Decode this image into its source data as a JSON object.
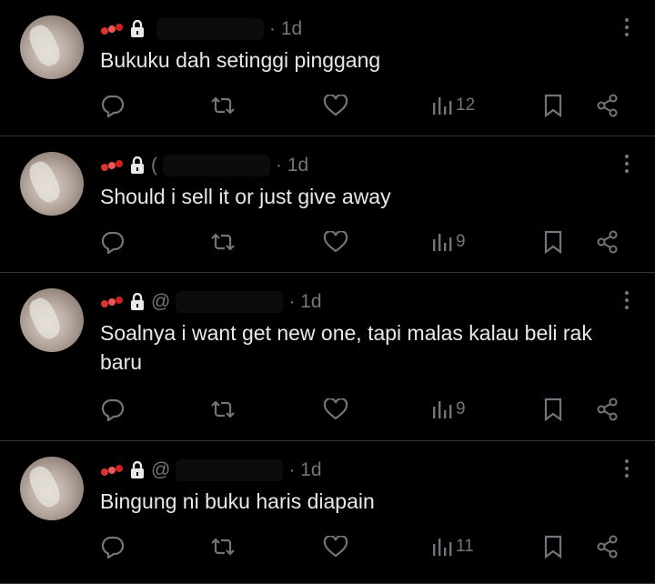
{
  "tweets": [
    {
      "badge_icon": "emoji-badge-icon",
      "handle": "",
      "time": "· 1d",
      "text": "Bukuku dah setinggi pinggang",
      "views": "12"
    },
    {
      "badge_icon": "emoji-badge-icon",
      "handle": "(",
      "time": "· 1d",
      "text": "Should i sell it or just give away",
      "views": "9"
    },
    {
      "badge_icon": "emoji-badge-icon",
      "handle": "@",
      "time": "· 1d",
      "text": "Soalnya i want get new one, tapi malas kalau beli rak baru",
      "views": "9"
    },
    {
      "badge_icon": "emoji-badge-icon",
      "handle": "@",
      "time": "· 1d",
      "text": "Bingung ni buku haris diapain",
      "views": "11"
    }
  ],
  "icons": [
    "reply-icon",
    "retweet-icon",
    "like-icon",
    "views-icon",
    "bookmark-icon",
    "share-icon",
    "lock-icon",
    "more-icon"
  ],
  "colors": {
    "background": "#000000",
    "text": "#e7e9ea",
    "muted": "#71767b",
    "divider": "#2f3336"
  }
}
